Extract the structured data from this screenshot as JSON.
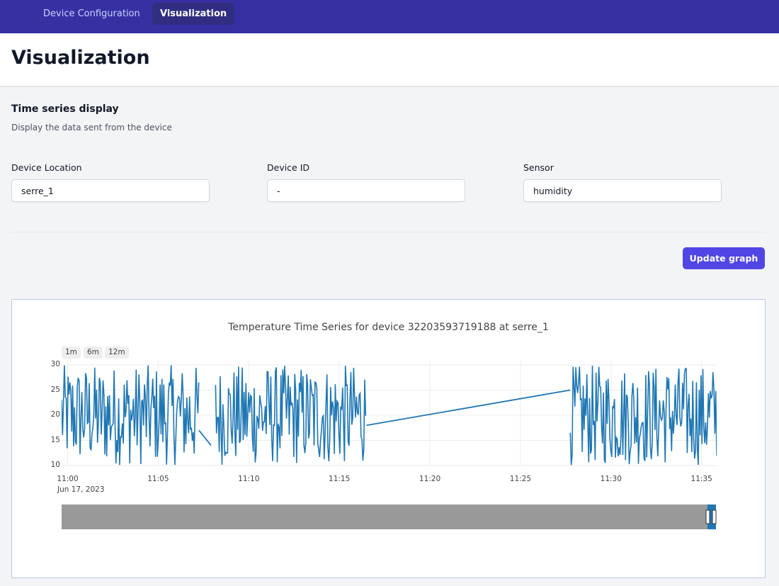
{
  "nav": {
    "tabs": [
      {
        "label": "Device Configuration",
        "active": false
      },
      {
        "label": "Visualization",
        "active": true
      }
    ]
  },
  "page": {
    "title": "Visualization"
  },
  "section": {
    "title": "Time series display",
    "subtitle": "Display the data sent from the device"
  },
  "form": {
    "location": {
      "label": "Device Location",
      "value": "serre_1"
    },
    "device_id": {
      "label": "Device ID",
      "value": "-"
    },
    "sensor": {
      "label": "Sensor",
      "value": "humidity"
    }
  },
  "actions": {
    "update_label": "Update graph"
  },
  "chart": {
    "range_buttons": [
      "1m",
      "6m",
      "12m"
    ],
    "date_label": "Jun 17, 2023"
  },
  "colors": {
    "nav_bg": "#3730a3",
    "nav_active": "#312e81",
    "button": "#4f46e5",
    "series": "#1f77b4"
  },
  "chart_data": {
    "type": "line",
    "title": "Temperature Time Series for device 32203593719188 at serre_1",
    "xlabel": "",
    "ylabel": "",
    "x_ticks": [
      "11:00",
      "11:05",
      "11:10",
      "11:15",
      "11:20",
      "11:25",
      "11:30",
      "11:35"
    ],
    "y_ticks": [
      10,
      15,
      20,
      25,
      30
    ],
    "ylim": [
      10,
      30
    ],
    "xlim": [
      "10:59:40",
      "11:35:50"
    ],
    "grid": true,
    "series": [
      {
        "segments": [
          {
            "start": "10:59:40",
            "end": "11:07:15",
            "min": 10,
            "max": 30
          },
          {
            "start": "11:08:10",
            "end": "11:16:30",
            "min": 10,
            "max": 30
          },
          {
            "start": "11:27:45",
            "end": "11:35:50",
            "min": 10,
            "max": 30
          }
        ],
        "connectors": [
          {
            "from": [
              "11:07:15",
              17
            ],
            "to": [
              "11:07:55",
              14
            ]
          },
          {
            "from": [
              "11:16:30",
              18
            ],
            "to": [
              "11:27:45",
              25
            ]
          }
        ]
      }
    ]
  }
}
